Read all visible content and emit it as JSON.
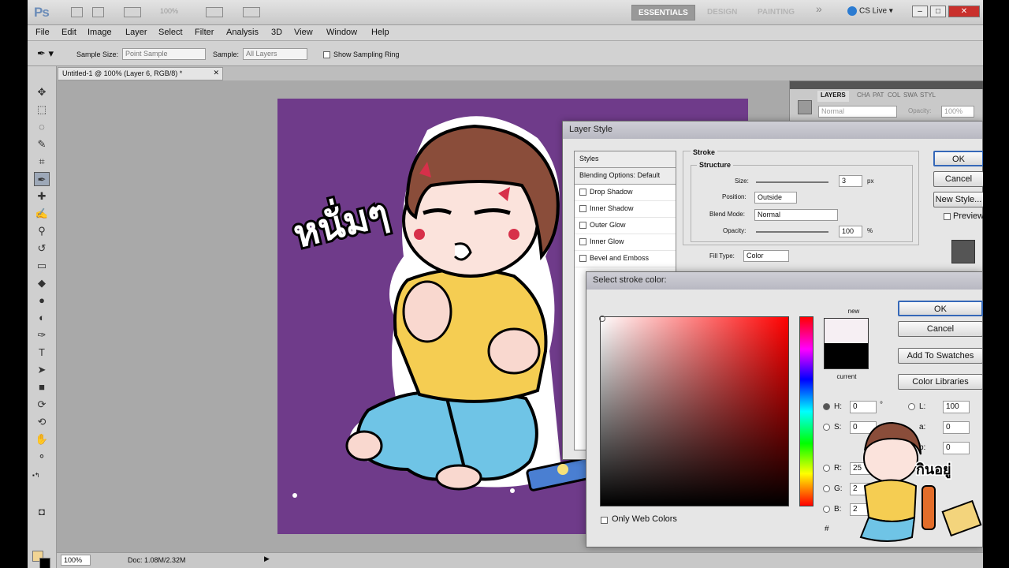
{
  "app": {
    "logo": "Ps",
    "zoom_menu": "100%"
  },
  "workspace": {
    "essentials": "ESSENTIALS",
    "design": "DESIGN",
    "painting": "PAINTING",
    "more": "»",
    "cs_live": "CS Live"
  },
  "window_controls": {
    "minimize": "–",
    "maximize": "□",
    "close": "✕"
  },
  "menu": [
    "File",
    "Edit",
    "Image",
    "Layer",
    "Select",
    "Filter",
    "Analysis",
    "3D",
    "View",
    "Window",
    "Help"
  ],
  "options": {
    "sample_size_label": "Sample Size:",
    "sample_size_value": "Point Sample",
    "sample_label": "Sample:",
    "sample_value": "All Layers",
    "show_ring": "Show Sampling Ring"
  },
  "document_tab": {
    "title": "Untitled-1 @ 100% (Layer 6, RGB/8) *"
  },
  "status": {
    "zoom": "100%",
    "doc": "Doc: 1.08M/2.32M"
  },
  "layers_panel": {
    "tabs": [
      "LAYERS",
      "CHA",
      "PAT",
      "COL",
      "SWA",
      "STYL"
    ],
    "blend": "Normal",
    "opacity_label": "Opacity:",
    "opacity_value": "100%"
  },
  "layer_style": {
    "title": "Layer Style",
    "styles": [
      "Styles",
      "Blending Options: Default",
      "Drop Shadow",
      "Inner Shadow",
      "Outer Glow",
      "Inner Glow",
      "Bevel and Emboss"
    ],
    "section": "Stroke",
    "subsection": "Structure",
    "size_label": "Size:",
    "size_value": "3",
    "size_unit": "px",
    "position_label": "Position:",
    "position_value": "Outside",
    "blend_label": "Blend Mode:",
    "blend_value": "Normal",
    "opacity_label": "Opacity:",
    "opacity_value": "100",
    "opacity_unit": "%",
    "fill_type_label": "Fill Type:",
    "fill_type_value": "Color",
    "ok": "OK",
    "cancel": "Cancel",
    "new_style": "New Style...",
    "preview": "Preview"
  },
  "stroke_color": {
    "title": "Select stroke color:",
    "new_label": "new",
    "current_label": "current",
    "new_color": "#f6eff3",
    "current_color": "#000000",
    "ok": "OK",
    "cancel": "Cancel",
    "add_swatches": "Add To Swatches",
    "color_libraries": "Color Libraries",
    "only_web": "Only Web Colors",
    "fields": [
      {
        "k": "H:",
        "v": "0",
        "u": "°"
      },
      {
        "k": "S:",
        "v": "0",
        "u": ""
      },
      {
        "k": "R:",
        "v": "25",
        "u": ""
      },
      {
        "k": "G:",
        "v": "2",
        "u": ""
      },
      {
        "k": "B:",
        "v": "2",
        "u": ""
      }
    ],
    "lab": [
      {
        "k": "L:",
        "v": "100"
      },
      {
        "k": "a:",
        "v": "0"
      },
      {
        "k": "b:",
        "v": "0"
      }
    ],
    "hash": "#"
  },
  "artwork": {
    "thai_text": "หนั่มๆ",
    "sticker_text": "กินอยู่"
  },
  "colors": {
    "canvas": "#6f3b8a",
    "fg": "#f1d494",
    "bg": "#000000"
  }
}
